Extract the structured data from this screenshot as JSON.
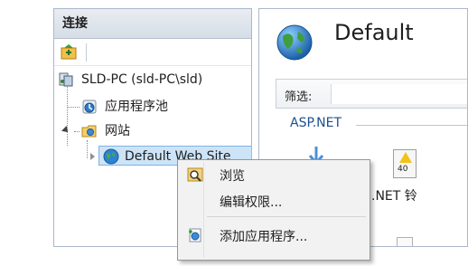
{
  "connections_panel": {
    "title": "连接",
    "tree": {
      "server": "SLD-PC (sld-PC\\sld)",
      "app_pools": "应用程序池",
      "sites": "网站",
      "default_site": "Default Web Site"
    }
  },
  "content_panel": {
    "title": "Default",
    "filter_label": "筛选:",
    "section": "ASP.NET",
    "partial_feature_text": ".NET 铃",
    "partial_icon_text": "40"
  },
  "context_menu": {
    "items": [
      {
        "label": "浏览",
        "icon": "explore-icon"
      },
      {
        "label": "编辑权限...",
        "icon": ""
      },
      {
        "label": "添加应用程序...",
        "icon": "add-application-icon"
      }
    ]
  },
  "colors": {
    "panel_header": "#d6dde6",
    "selection": "#cde4f7",
    "section_text": "#1a4f8f",
    "menu_background": "#f2f2f2"
  }
}
